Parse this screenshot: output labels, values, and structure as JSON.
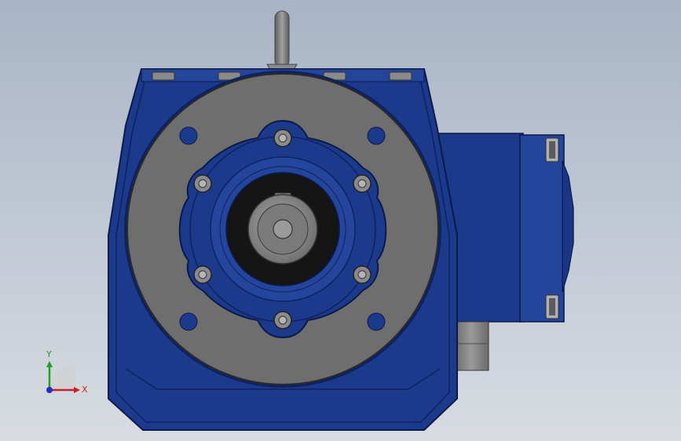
{
  "viewport": {
    "background_top": "#a8b4c6",
    "background_bottom": "#d8dce2"
  },
  "model": {
    "housing_color": "#1c3a8c",
    "housing_dark": "#0e2260",
    "housing_light": "#2e4fa8",
    "flange_gray": "#6e6e6e",
    "bore_black": "#151515",
    "shaft_gray": "#8a8a8a",
    "handle_gray": "#7f7f7f"
  },
  "triad": {
    "x_label": "X",
    "y_label": "Y",
    "x_color": "#cc2020",
    "y_color": "#20a020",
    "z_color": "#2030c0"
  }
}
